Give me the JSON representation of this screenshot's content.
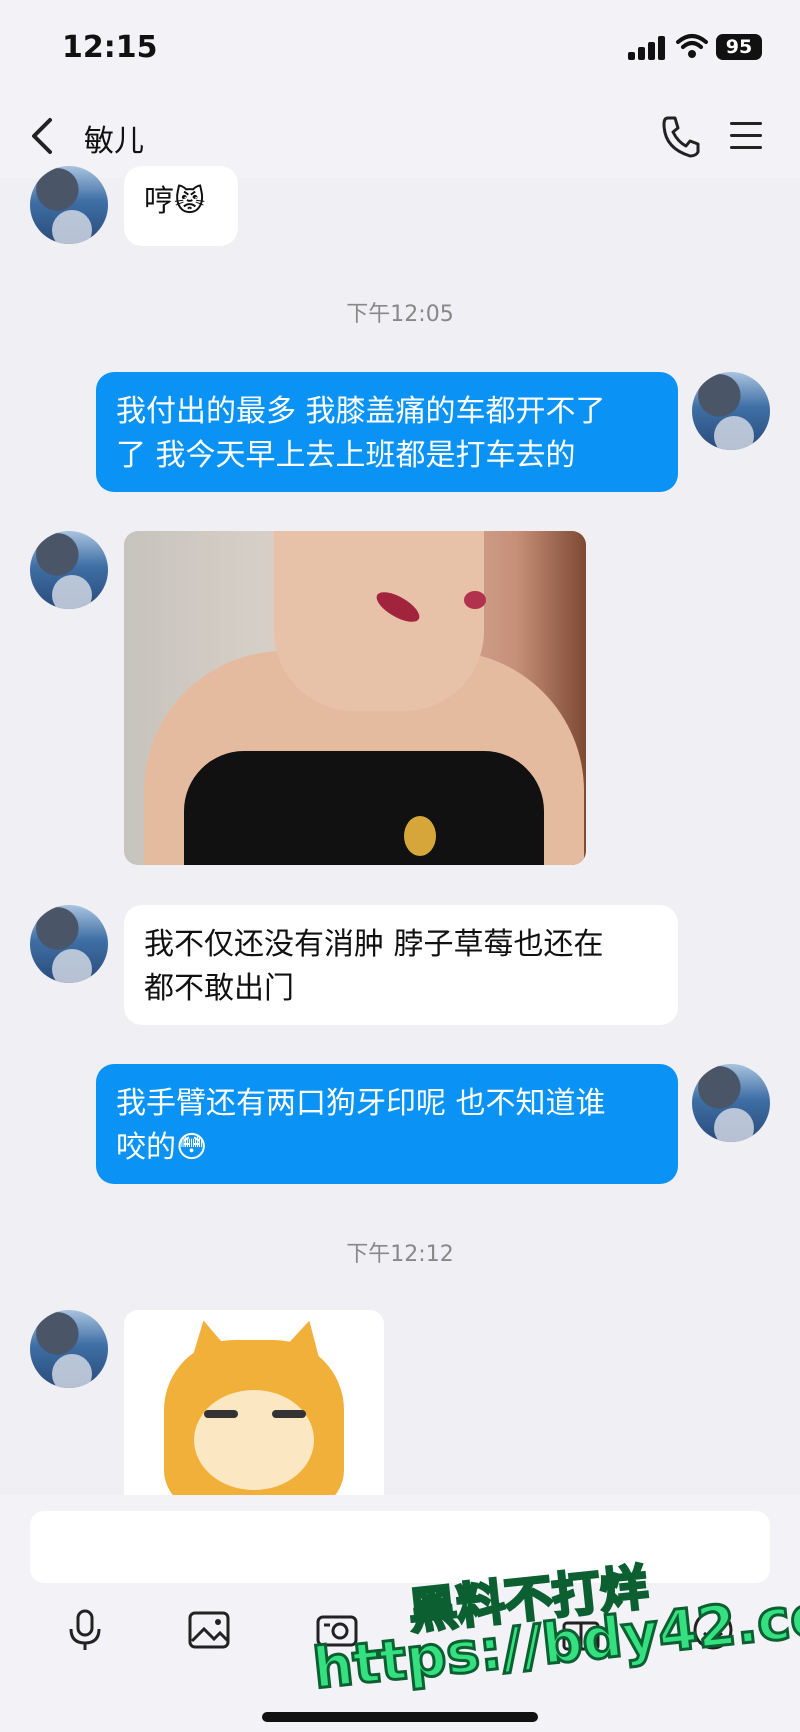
{
  "status_bar": {
    "time": "12:15",
    "battery": "95"
  },
  "nav": {
    "contact_name": "敏儿"
  },
  "messages": [
    {
      "type": "incoming",
      "text": "哼",
      "emoji": "😾"
    },
    {
      "type": "timestamp",
      "text": "下午12:05"
    },
    {
      "type": "outgoing",
      "line1": "我付出的最多 我膝盖痛的车都开不了",
      "line2": "了 我今天早上去上班都是打车去的"
    },
    {
      "type": "incoming-image",
      "icon": "photo"
    },
    {
      "type": "incoming",
      "line1": "我不仅还没有消肿 脖子草莓也还在",
      "line2": "都不敢出门"
    },
    {
      "type": "outgoing",
      "line1": "我手臂还有两口狗牙印呢 也不知道谁",
      "line2": "咬的",
      "emoji": "😳"
    },
    {
      "type": "timestamp",
      "text": "下午12:12"
    },
    {
      "type": "incoming-sticker",
      "icon": "doge-sticker"
    }
  ],
  "input_bar": {
    "placeholder": "",
    "tools": [
      "microphone-icon",
      "image-icon",
      "camera-icon",
      "gift-icon",
      "emoji-icon"
    ]
  },
  "watermark": {
    "line1": "黑料不打烊",
    "line2": "https://bdy42.co"
  }
}
